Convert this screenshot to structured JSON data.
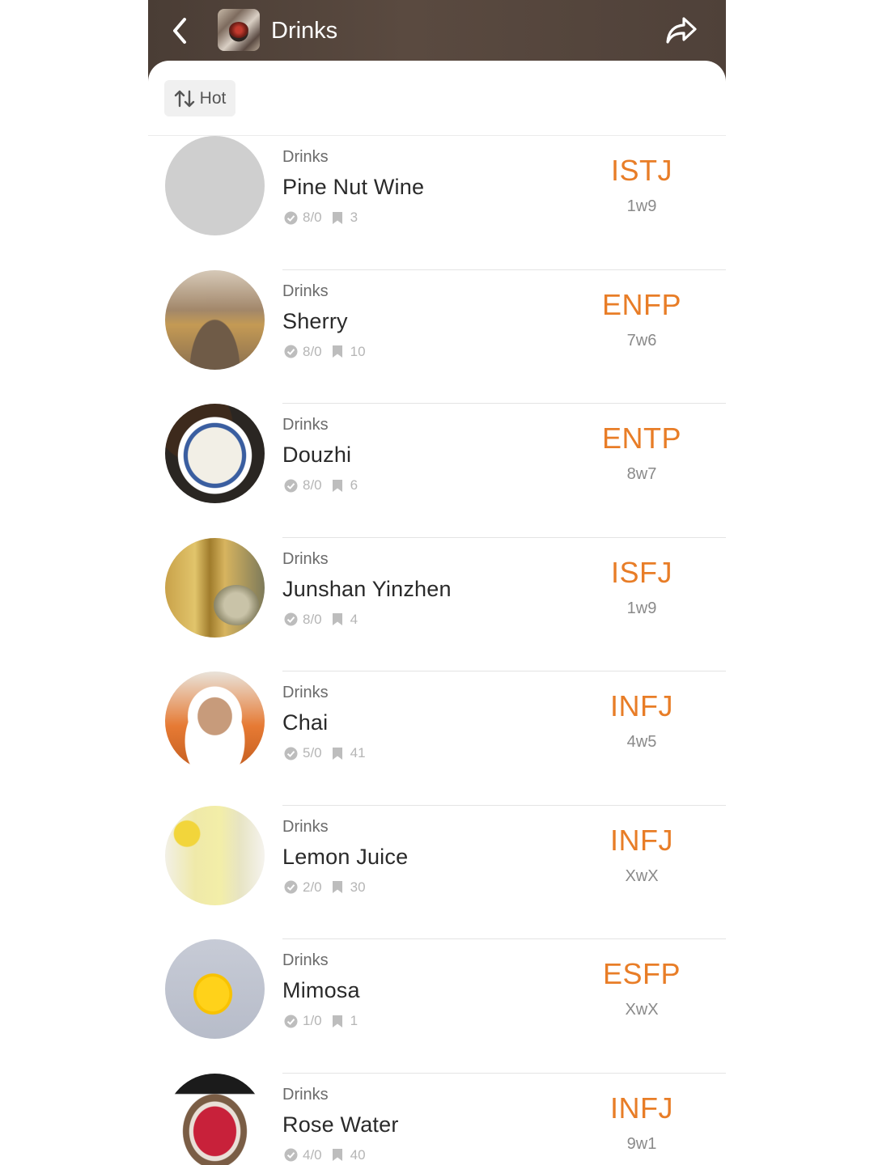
{
  "header": {
    "title": "Drinks",
    "back_icon": "chevron-left-icon",
    "share_icon": "share-arrow-icon"
  },
  "toolbar": {
    "sort_label": "Hot",
    "sort_icon": "sort-arrows-icon"
  },
  "items": [
    {
      "category": "Drinks",
      "title": "Pine Nut Wine",
      "votes": "8/0",
      "comments": "3",
      "mbti": "ISTJ",
      "wing": "1w9"
    },
    {
      "category": "Drinks",
      "title": "Sherry",
      "votes": "8/0",
      "comments": "10",
      "mbti": "ENFP",
      "wing": "7w6"
    },
    {
      "category": "Drinks",
      "title": "Douzhi",
      "votes": "8/0",
      "comments": "6",
      "mbti": "ENTP",
      "wing": "8w7"
    },
    {
      "category": "Drinks",
      "title": "Junshan Yinzhen",
      "votes": "8/0",
      "comments": "4",
      "mbti": "ISFJ",
      "wing": "1w9"
    },
    {
      "category": "Drinks",
      "title": "Chai",
      "votes": "5/0",
      "comments": "41",
      "mbti": "INFJ",
      "wing": "4w5"
    },
    {
      "category": "Drinks",
      "title": "Lemon Juice",
      "votes": "2/0",
      "comments": "30",
      "mbti": "INFJ",
      "wing": "XwX"
    },
    {
      "category": "Drinks",
      "title": "Mimosa",
      "votes": "1/0",
      "comments": "1",
      "mbti": "ESFP",
      "wing": "XwX"
    },
    {
      "category": "Drinks",
      "title": "Rose Water",
      "votes": "4/0",
      "comments": "40",
      "mbti": "INFJ",
      "wing": "9w1"
    }
  ],
  "colors": {
    "accent": "#e87d27",
    "header_bg": "#4f4139",
    "muted": "#b5b5b5"
  }
}
